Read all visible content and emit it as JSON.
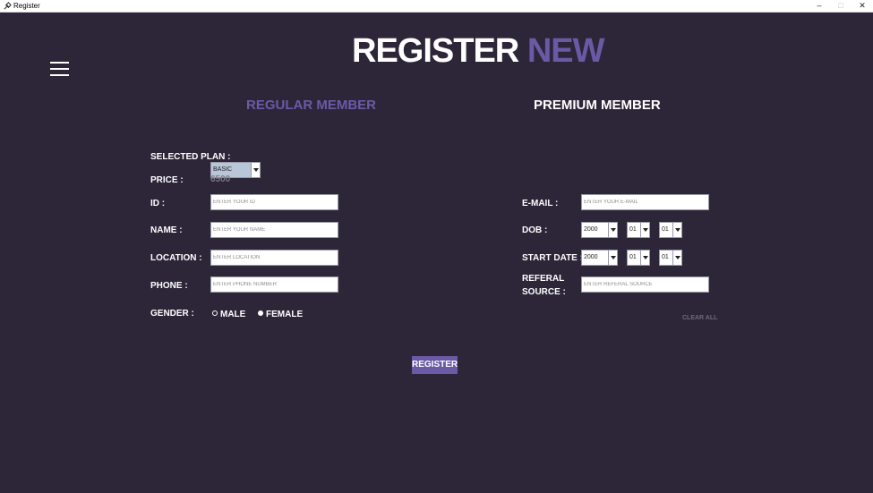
{
  "window": {
    "title": "Register"
  },
  "heading": {
    "part1": "REGISTER",
    "part2": "NEW"
  },
  "tabs": {
    "regular": "REGULAR MEMBER",
    "premium": "PREMIUM MEMBER"
  },
  "left_form": {
    "selected_plan_label": "SELECTED PLAN :",
    "selected_plan_value": "BASIC",
    "price_label": "PRICE :",
    "price_value": "6500",
    "id_label": "ID :",
    "id_placeholder": "ENTER YOUR ID",
    "name_label": "NAME :",
    "name_placeholder": "ENTER YOUR NAME",
    "location_label": "LOCATION :",
    "location_placeholder": "ENTER LOCATION",
    "phone_label": "PHONE :",
    "phone_placeholder": "ENTER PHONE NUMBER",
    "gender_label": "GENDER :",
    "gender_options": [
      "MALE",
      "FEMALE"
    ]
  },
  "right_form": {
    "email_label": "E-MAIL :",
    "email_placeholder": "ENTER YOUR E-MAIL",
    "dob_label": "DOB :",
    "dob": {
      "year": "2000",
      "month": "01",
      "day": "01"
    },
    "start_label": "START DATE :",
    "start": {
      "year": "2000",
      "month": "01",
      "day": "01"
    },
    "referal_label_1": "REFERAL",
    "referal_label_2": "SOURCE :",
    "referal_placeholder": "ENTER REFERAL SOURCE",
    "clear_all": "CLEAR ALL"
  },
  "register_button": "REGISTER",
  "colors": {
    "background": "#2d2639",
    "accent": "#6a5aa6",
    "muted": "#7d7a86"
  }
}
